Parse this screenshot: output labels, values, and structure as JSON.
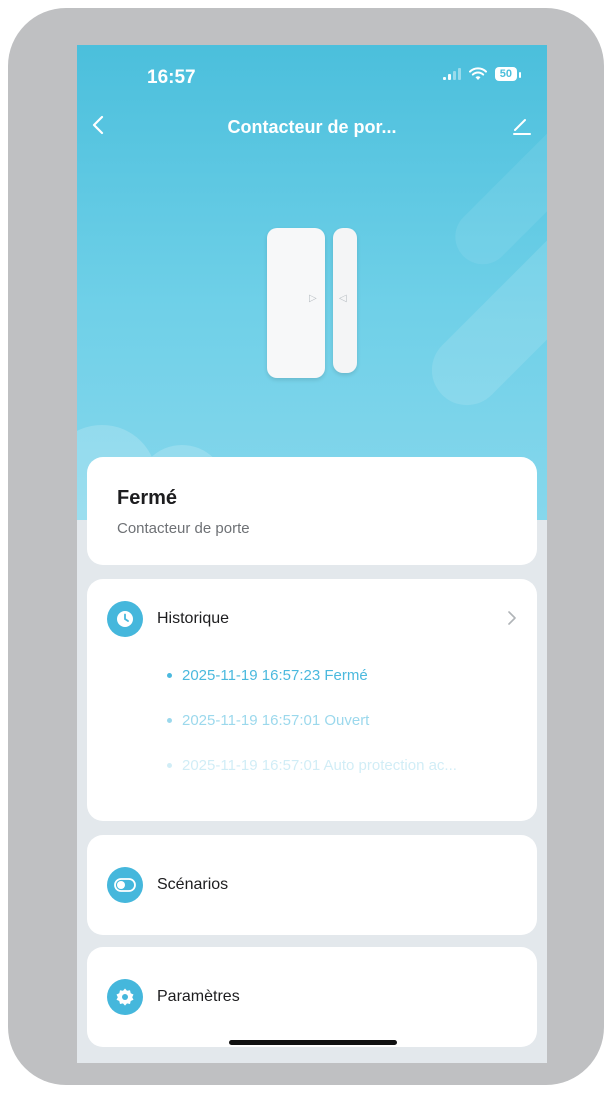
{
  "status_bar": {
    "time": "16:57",
    "battery": "50",
    "icons": [
      "signal-icon",
      "wifi-icon",
      "battery-icon"
    ]
  },
  "nav": {
    "title": "Contacteur de por...",
    "back_icon": "chevron-left-icon",
    "edit_icon": "pencil-icon"
  },
  "device": {
    "illustration": "door-contact-sensor"
  },
  "status_card": {
    "state": "Fermé",
    "device_type": "Contacteur de porte"
  },
  "history": {
    "label": "Historique",
    "icon": "clock-icon",
    "events": [
      {
        "text": "2025-11-19 16:57:23 Fermé"
      },
      {
        "text": "2025-11-19 16:57:01 Ouvert"
      },
      {
        "text": "2025-11-19 16:57:01 Auto protection ac..."
      }
    ]
  },
  "scenarios": {
    "label": "Scénarios",
    "icon": "toggle-icon"
  },
  "settings": {
    "label": "Paramètres",
    "icon": "gear-icon"
  },
  "colors": {
    "accent": "#45b7dc",
    "hero_top": "#4bbfdc",
    "hero_bottom": "#86d7ec",
    "background": "#e3e8ec"
  }
}
